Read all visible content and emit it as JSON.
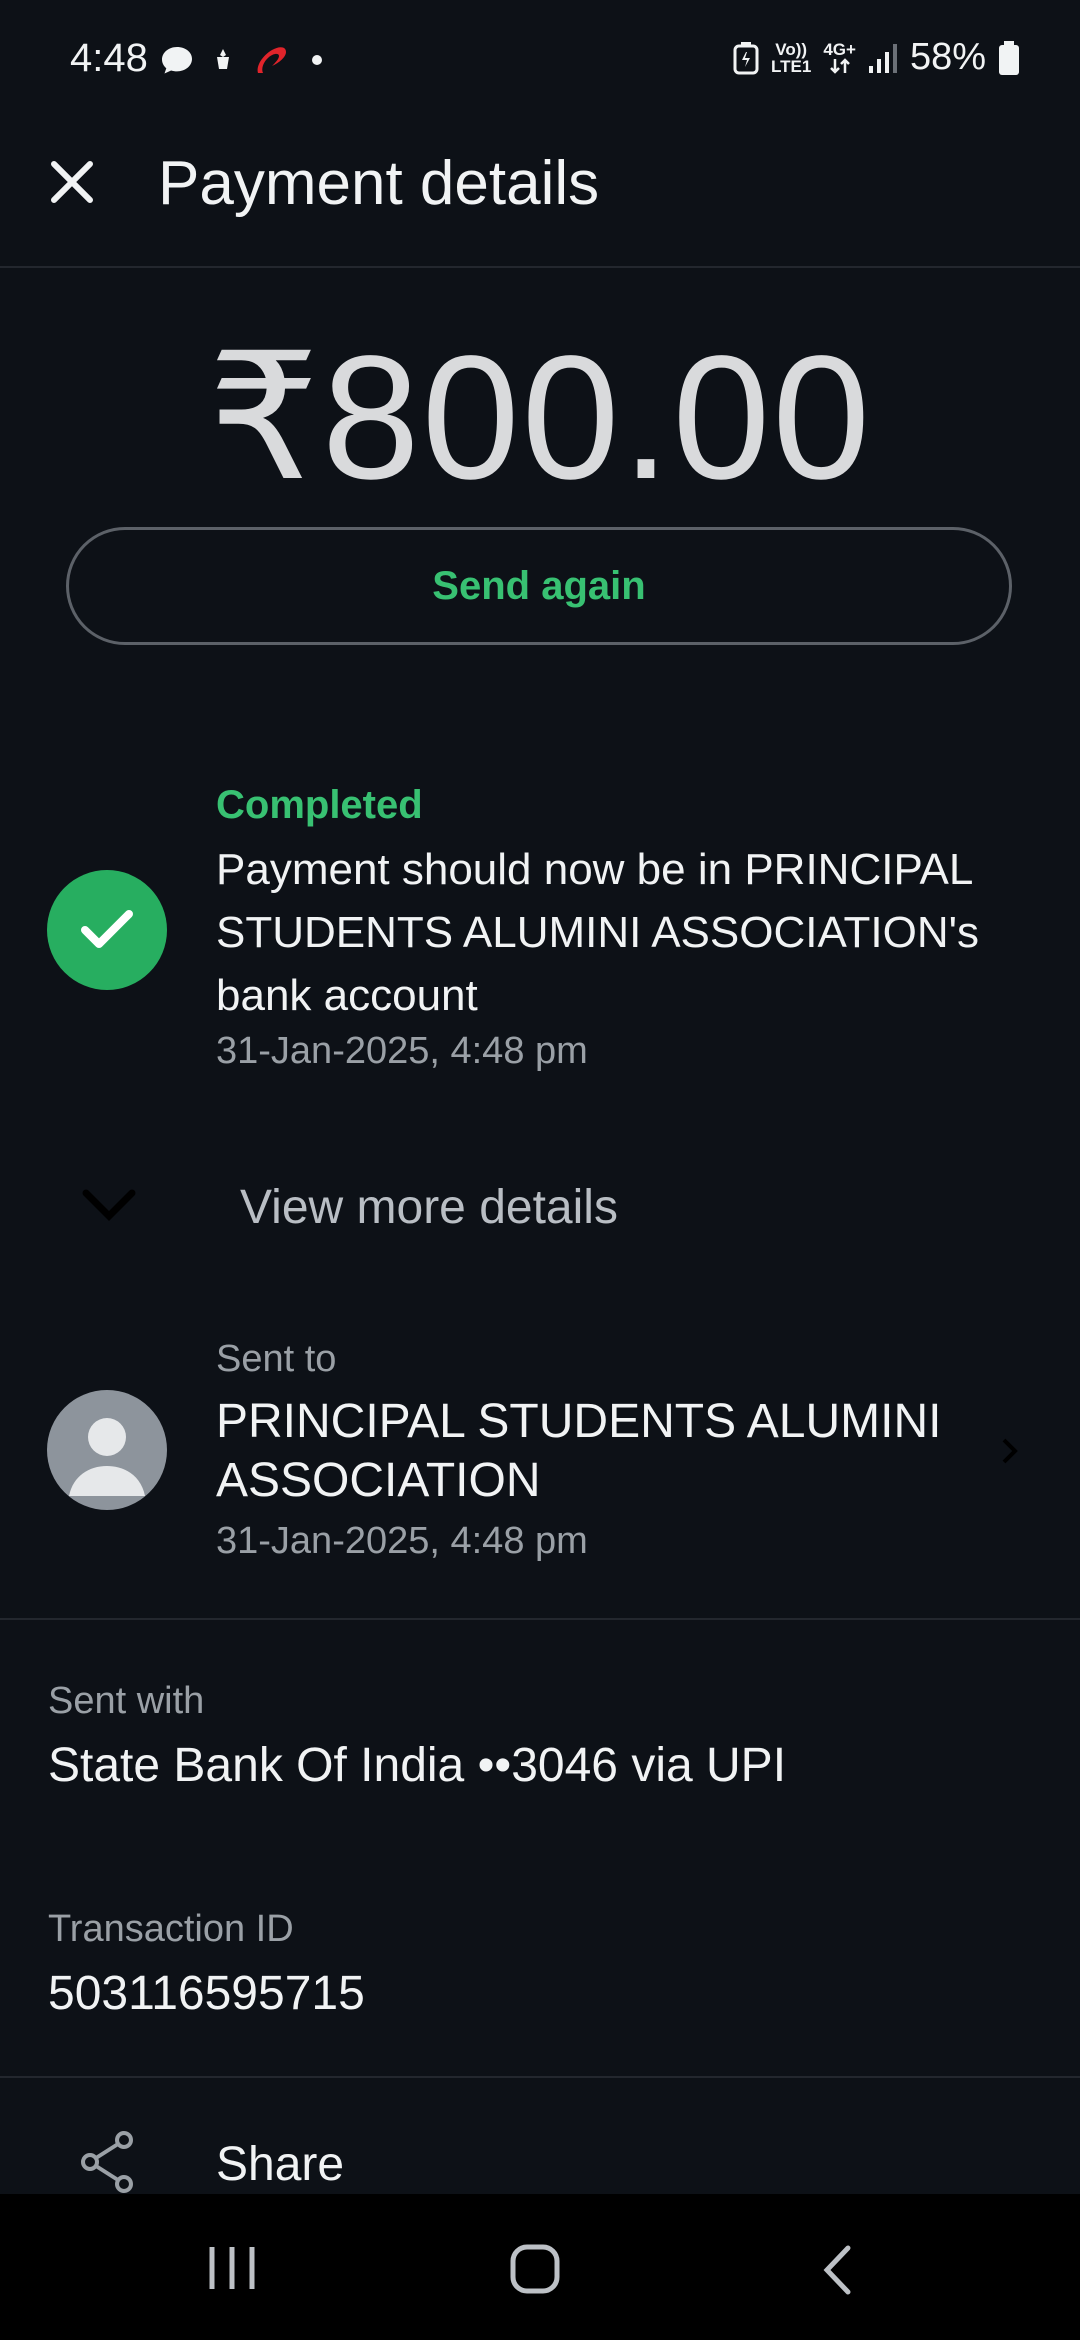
{
  "status_bar": {
    "time": "4:48",
    "icons_left": [
      "chat-bubble-icon",
      "app-notification-icon",
      "airtel-icon",
      "dot-icon"
    ],
    "network_volte": "Vo))",
    "network_lte": "LTE1",
    "network_4g": "4G+",
    "battery": "58%"
  },
  "header": {
    "title": "Payment details",
    "close_icon": "close-icon"
  },
  "payment": {
    "amount": "₹800.00",
    "send_again_label": "Send again"
  },
  "status": {
    "state": "Completed",
    "message": "Payment should now be in PRINCIPAL STUDENTS ALUMINI ASSOCIATION's bank account",
    "timestamp": "31-Jan-2025, 4:48 pm"
  },
  "view_more": {
    "label": "View more details"
  },
  "sent_to": {
    "label": "Sent to",
    "name": "PRINCIPAL STUDENTS ALUMINI ASSOCIATION",
    "timestamp": "31-Jan-2025, 4:48 pm"
  },
  "sent_with": {
    "label": "Sent with",
    "value": "State Bank Of India ••3046 via UPI"
  },
  "transaction": {
    "label": "Transaction ID",
    "value": "503116595715"
  },
  "share": {
    "label": "Share"
  },
  "colors": {
    "background": "#0d1117",
    "accent_green": "#38c172",
    "check_green": "#27ae60"
  }
}
